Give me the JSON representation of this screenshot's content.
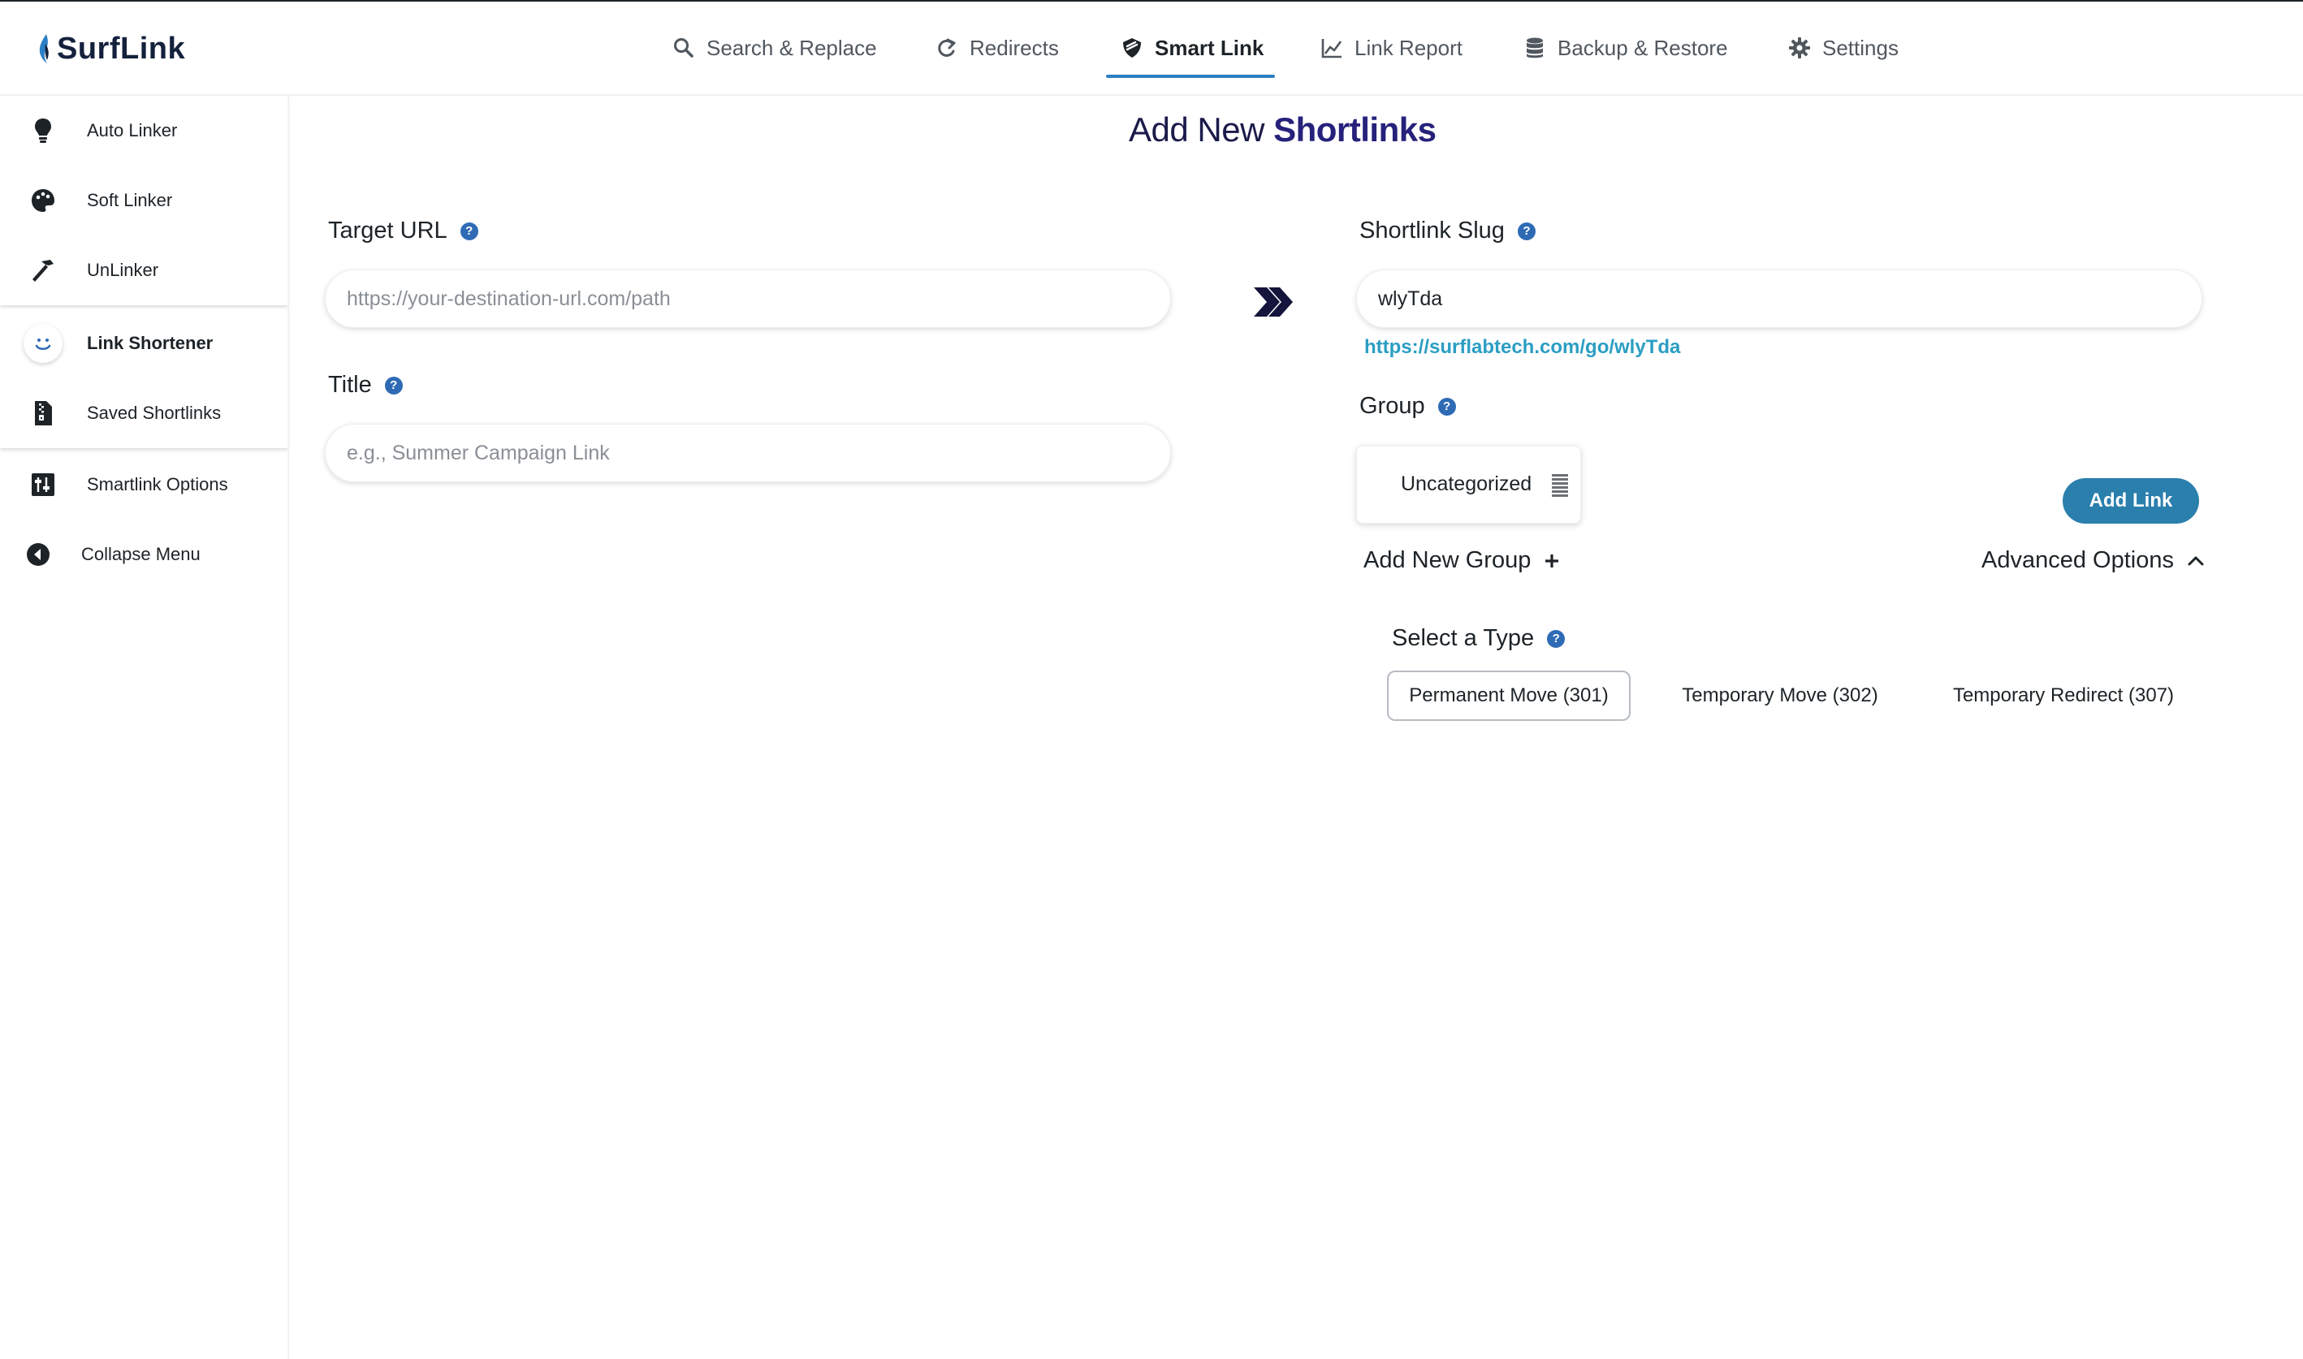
{
  "app": {
    "logo_text": "SurfLink",
    "accent": "#2b80c5"
  },
  "nav": {
    "items": [
      {
        "label": "Search & Replace",
        "icon": "search-icon"
      },
      {
        "label": "Redirects",
        "icon": "redirect-arrow-icon"
      },
      {
        "label": "Smart Link",
        "icon": "smart-link-icon",
        "active": true
      },
      {
        "label": "Link Report",
        "icon": "chart-line-icon"
      },
      {
        "label": "Backup & Restore",
        "icon": "database-icon"
      },
      {
        "label": "Settings",
        "icon": "gear-icon"
      }
    ]
  },
  "sidebar": {
    "items": [
      {
        "label": "Auto Linker",
        "icon": "lightbulb-icon"
      },
      {
        "label": "Soft Linker",
        "icon": "palette-icon"
      },
      {
        "label": "UnLinker",
        "icon": "hammer-icon"
      },
      {
        "label": "Link Shortener",
        "icon": "smile-icon",
        "active": true
      },
      {
        "label": "Saved Shortlinks",
        "icon": "file-zipper-icon"
      },
      {
        "label": "Smartlink Options",
        "icon": "sliders-icon"
      },
      {
        "label": "Collapse Menu",
        "icon": "collapse-arrow-icon"
      }
    ]
  },
  "main": {
    "title_part1": "Add New ",
    "title_part2": "Shortlinks",
    "target_url": {
      "label": "Target URL",
      "placeholder": "https://your-destination-url.com/path",
      "value": ""
    },
    "title_field": {
      "label": "Title",
      "placeholder": "e.g., Summer Campaign Link",
      "value": ""
    },
    "slug": {
      "label": "Shortlink Slug",
      "value": "wlyTda",
      "preview_url": "https://surflabtech.com/go/wlyTda"
    },
    "group": {
      "label": "Group",
      "selected": "Uncategorized"
    },
    "help_glyph": "?",
    "add_link_label": "Add Link",
    "add_group_label": "Add New Group",
    "advanced_label": "Advanced Options",
    "type": {
      "label": "Select a Type",
      "options": [
        {
          "label": "Permanent Move (301)",
          "selected": true
        },
        {
          "label": "Temporary Move (302)",
          "selected": false
        },
        {
          "label": "Temporary Redirect (307)",
          "selected": false
        }
      ]
    }
  }
}
